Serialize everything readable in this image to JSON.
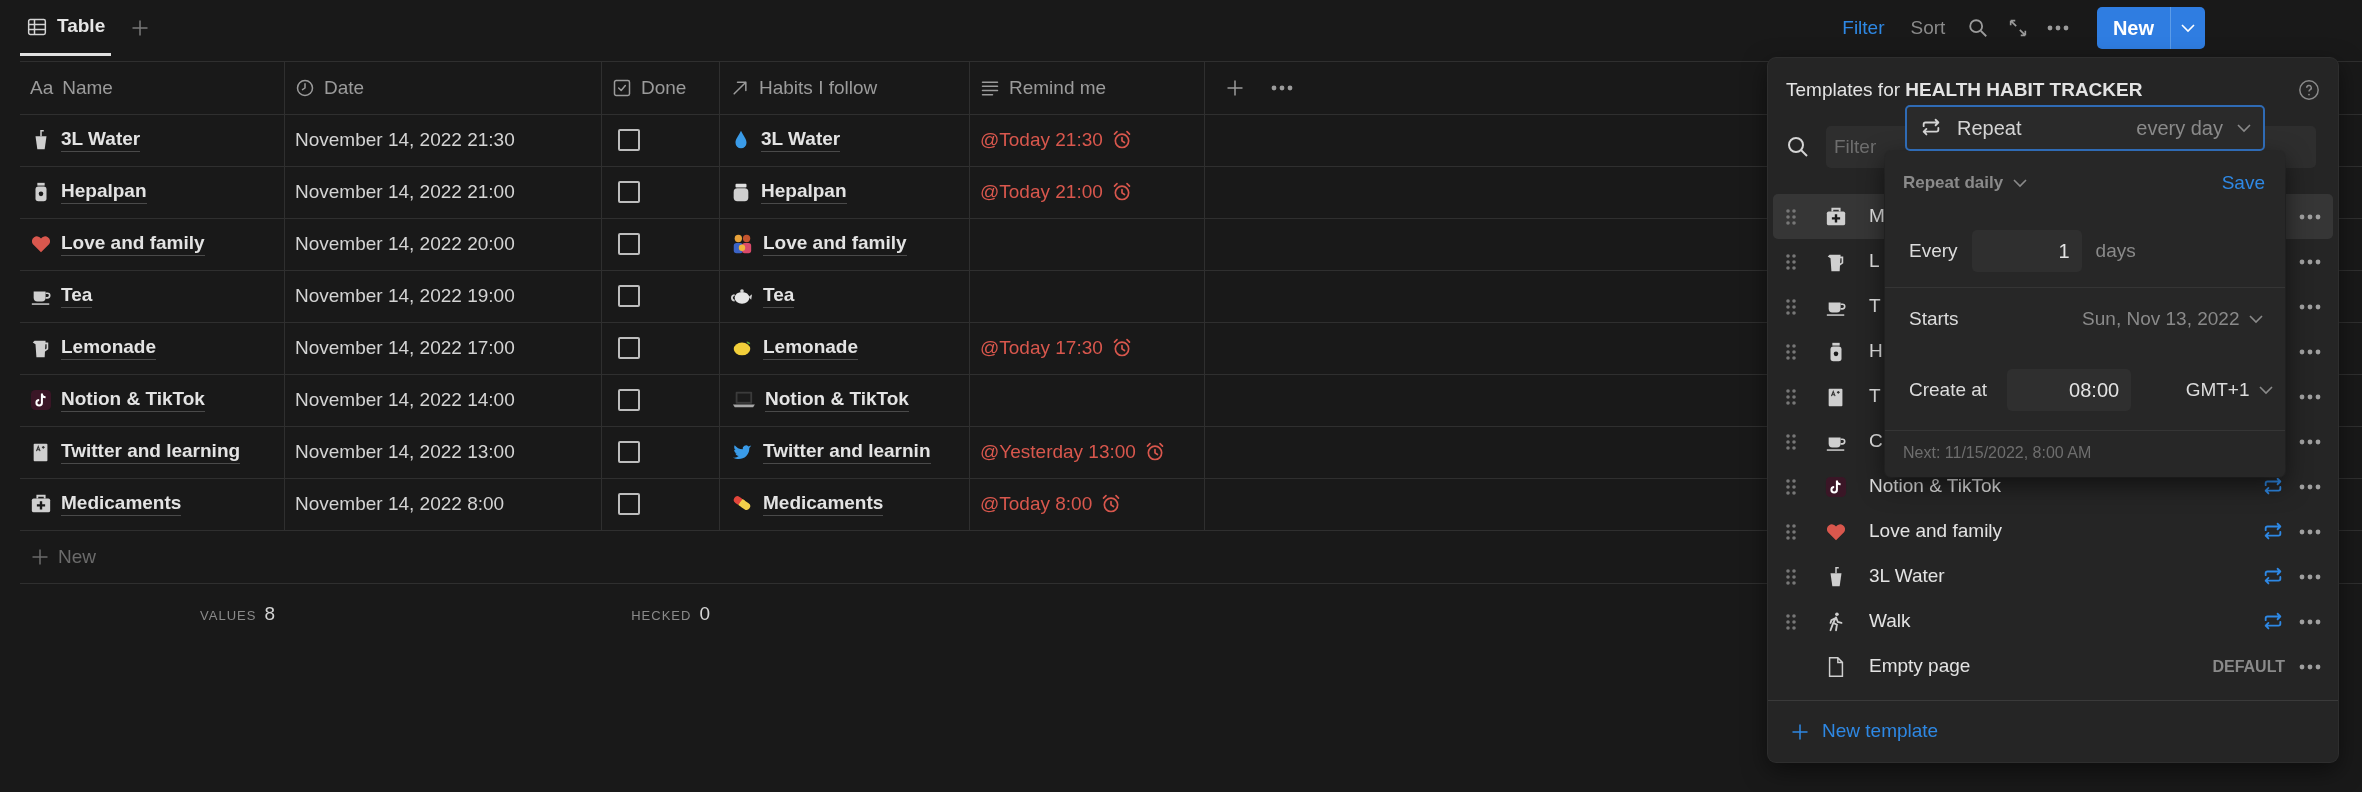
{
  "view_tabs": [
    {
      "label": "Table",
      "selected": true
    }
  ],
  "toolbar": {
    "filter": "Filter",
    "sort": "Sort",
    "new_button": "New"
  },
  "table": {
    "columns": [
      {
        "kind": "title",
        "icon_text": "Aa",
        "label": "Name"
      },
      {
        "kind": "date",
        "label": "Date"
      },
      {
        "kind": "checkbox",
        "label": "Done"
      },
      {
        "kind": "relation",
        "label": "Habits I follow"
      },
      {
        "kind": "text",
        "label": "Remind me"
      }
    ],
    "rows": [
      {
        "name": "3L Water",
        "date": "November 14, 2022 21:30",
        "done": false,
        "habit": "3L Water",
        "remind": "@Today 21:30"
      },
      {
        "name": "Hepalpan",
        "date": "November 14, 2022 21:00",
        "done": false,
        "habit": "Hepalpan",
        "remind": "@Today 21:00"
      },
      {
        "name": "Love and family",
        "date": "November 14, 2022 20:00",
        "done": false,
        "habit": "Love and family"
      },
      {
        "name": "Tea",
        "date": "November 14, 2022 19:00",
        "done": false,
        "habit": "Tea"
      },
      {
        "name": "Lemonade",
        "date": "November 14, 2022 17:00",
        "done": false,
        "habit": "Lemonade",
        "remind": "@Today 17:30"
      },
      {
        "name": "Notion & TikTok",
        "date": "November 14, 2022 14:00",
        "done": false,
        "habit": "Notion & TikTok"
      },
      {
        "name": "Twitter and learning",
        "date": "November 14, 2022 13:00",
        "done": false,
        "habit": "Twitter and learnin",
        "remind": "@Yesterday 13:00"
      },
      {
        "name": "Medicaments",
        "date": "November 14, 2022 8:00",
        "done": false,
        "habit": "Medicaments",
        "remind": "@Today 8:00"
      }
    ],
    "new_row": "New",
    "footer": [
      {
        "label": "VALUES",
        "value": "8"
      },
      {
        "label": "HECKED",
        "value": "0"
      }
    ]
  },
  "templates_panel": {
    "title": "Templates for **HEALTH HABIT TRACKER**",
    "filter_placeholder": "Filter",
    "items": [
      {
        "label": "M",
        "selected": true,
        "repeat": false
      },
      {
        "label": "L",
        "selected": false,
        "repeat": false
      },
      {
        "label": "T",
        "selected": false,
        "repeat": false
      },
      {
        "label": "H",
        "selected": false,
        "repeat": false
      },
      {
        "label": "T",
        "selected": false,
        "repeat": false
      },
      {
        "label": "C",
        "selected": false,
        "repeat": false
      },
      {
        "label": "Notion & TikTok",
        "selected": false,
        "repeat": true
      },
      {
        "label": "Love and family",
        "selected": false,
        "repeat": true
      },
      {
        "label": "3L Water",
        "selected": false,
        "repeat": true
      },
      {
        "label": "Walk",
        "selected": false,
        "repeat": true
      },
      {
        "label": "Empty page",
        "selected": false,
        "repeat": false,
        "badge": "DEFAULT"
      }
    ],
    "new_template": "New template"
  },
  "repeat_popup": {
    "field_label": "Repeat",
    "field_value": "every day",
    "mode": "Repeat daily",
    "save": "Save",
    "every_label": "Every",
    "every_value": "1",
    "every_unit": "days",
    "starts_label": "Starts",
    "starts_value": "Sun, Nov 13, 2022",
    "create_label": "Create at",
    "create_value": "08:00",
    "timezone": "GMT+1",
    "next": "Next: 11/15/2022, 8:00 AM"
  }
}
